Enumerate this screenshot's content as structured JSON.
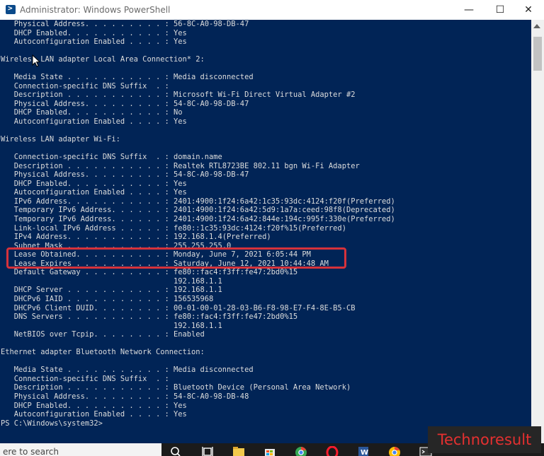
{
  "window": {
    "title": "Administrator: Windows PowerShell",
    "minimize_glyph": "—",
    "maximize_glyph": "☐",
    "close_glyph": "✕"
  },
  "console_lines": [
    "   Physical Address. . . . . . . . . : 56-8C-A0-98-DB-47",
    "   DHCP Enabled. . . . . . . . . . . : Yes",
    "   Autoconfiguration Enabled . . . . : Yes",
    "",
    "Wireless LAN adapter Local Area Connection* 2:",
    "",
    "   Media State . . . . . . . . . . . : Media disconnected",
    "   Connection-specific DNS Suffix  . :",
    "   Description . . . . . . . . . . . : Microsoft Wi-Fi Direct Virtual Adapter #2",
    "   Physical Address. . . . . . . . . : 54-8C-A0-98-DB-47",
    "   DHCP Enabled. . . . . . . . . . . : No",
    "   Autoconfiguration Enabled . . . . : Yes",
    "",
    "Wireless LAN adapter Wi-Fi:",
    "",
    "   Connection-specific DNS Suffix  . : domain.name",
    "   Description . . . . . . . . . . . : Realtek RTL8723BE 802.11 bgn Wi-Fi Adapter",
    "   Physical Address. . . . . . . . . : 54-8C-A0-98-DB-47",
    "   DHCP Enabled. . . . . . . . . . . : Yes",
    "   Autoconfiguration Enabled . . . . : Yes",
    "   IPv6 Address. . . . . . . . . . . : 2401:4900:1f24:6a42:1c35:93dc:4124:f20f(Preferred)",
    "   Temporary IPv6 Address. . . . . . : 2401:4900:1f24:6a42:5d9:1a7a:ceed:98f8(Deprecated)",
    "   Temporary IPv6 Address. . . . . . : 2401:4900:1f24:6a42:844e:194c:995f:330e(Preferred)",
    "   Link-local IPv6 Address . . . . . : fe80::1c35:93dc:4124:f20f%15(Preferred)",
    "   IPv4 Address. . . . . . . . . . . : 192.168.1.4(Preferred)",
    "   Subnet Mask . . . . . . . . . . . : 255.255.255.0",
    "   Lease Obtained. . . . . . . . . . : Monday, June 7, 2021 6:05:44 PM",
    "   Lease Expires . . . . . . . . . . : Saturday, June 12, 2021 10:44:48 AM",
    "   Default Gateway . . . . . . . . . : fe80::fac4:f3ff:fe47:2bd0%15",
    "                                       192.168.1.1",
    "   DHCP Server . . . . . . . . . . . : 192.168.1.1",
    "   DHCPv6 IAID . . . . . . . . . . . : 156535968",
    "   DHCPv6 Client DUID. . . . . . . . : 00-01-00-01-28-03-B6-F8-98-E7-F4-8E-B5-CB",
    "   DNS Servers . . . . . . . . . . . : fe80::fac4:f3ff:fe47:2bd0%15",
    "                                       192.168.1.1",
    "   NetBIOS over Tcpip. . . . . . . . : Enabled",
    "",
    "Ethernet adapter Bluetooth Network Connection:",
    "",
    "   Media State . . . . . . . . . . . : Media disconnected",
    "   Connection-specific DNS Suffix  . :",
    "   Description . . . . . . . . . . . : Bluetooth Device (Personal Area Network)",
    "   Physical Address. . . . . . . . . : 54-8C-A0-98-DB-48",
    "   DHCP Enabled. . . . . . . . . . . : Yes",
    "   Autoconfiguration Enabled . . . . : Yes",
    "PS C:\\Windows\\system32>"
  ],
  "taskbar": {
    "search_text": "ere to search",
    "icons": [
      "search-icon",
      "task-view-icon",
      "file-explorer-icon",
      "store-icon",
      "chrome-icon",
      "opera-icon",
      "word-icon",
      "chrome-icon",
      "terminal-icon"
    ]
  },
  "watermark": "Technoresult",
  "colors": {
    "console_bg": "#012456",
    "console_text": "#dcdcdc",
    "highlight_border": "#d6323b",
    "watermark_text": "#e53030"
  }
}
